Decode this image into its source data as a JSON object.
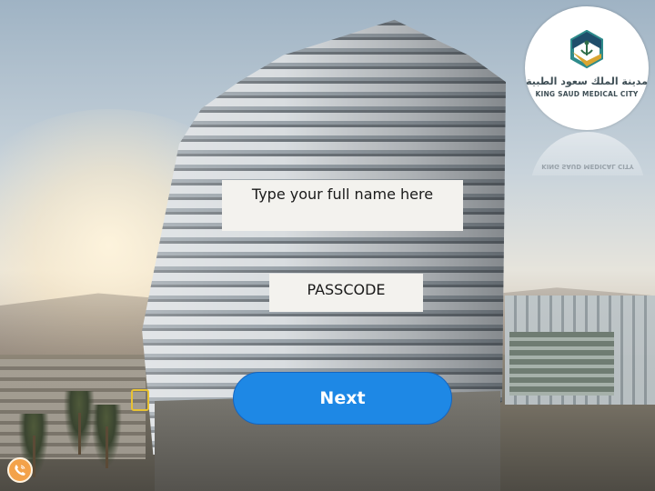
{
  "form": {
    "name_placeholder": "Type your full name here",
    "passcode_placeholder": "PASSCODE",
    "next_label": "Next"
  },
  "logo": {
    "arabic_text": "مدينة الملك سعود الطبية",
    "english_text": "KING SAUD MEDICAL CITY",
    "reflection_text": "KING SAUD MEDICAL CITY"
  },
  "icons": {
    "contact": "phone-call-icon",
    "marker": "hotspot-marker-icon"
  },
  "colors": {
    "button": "#1e88e5",
    "contact_button": "#f3a24a",
    "logo_teal": "#2e8b8b",
    "logo_gold": "#d9a531",
    "logo_navy": "#1f4e6b"
  }
}
